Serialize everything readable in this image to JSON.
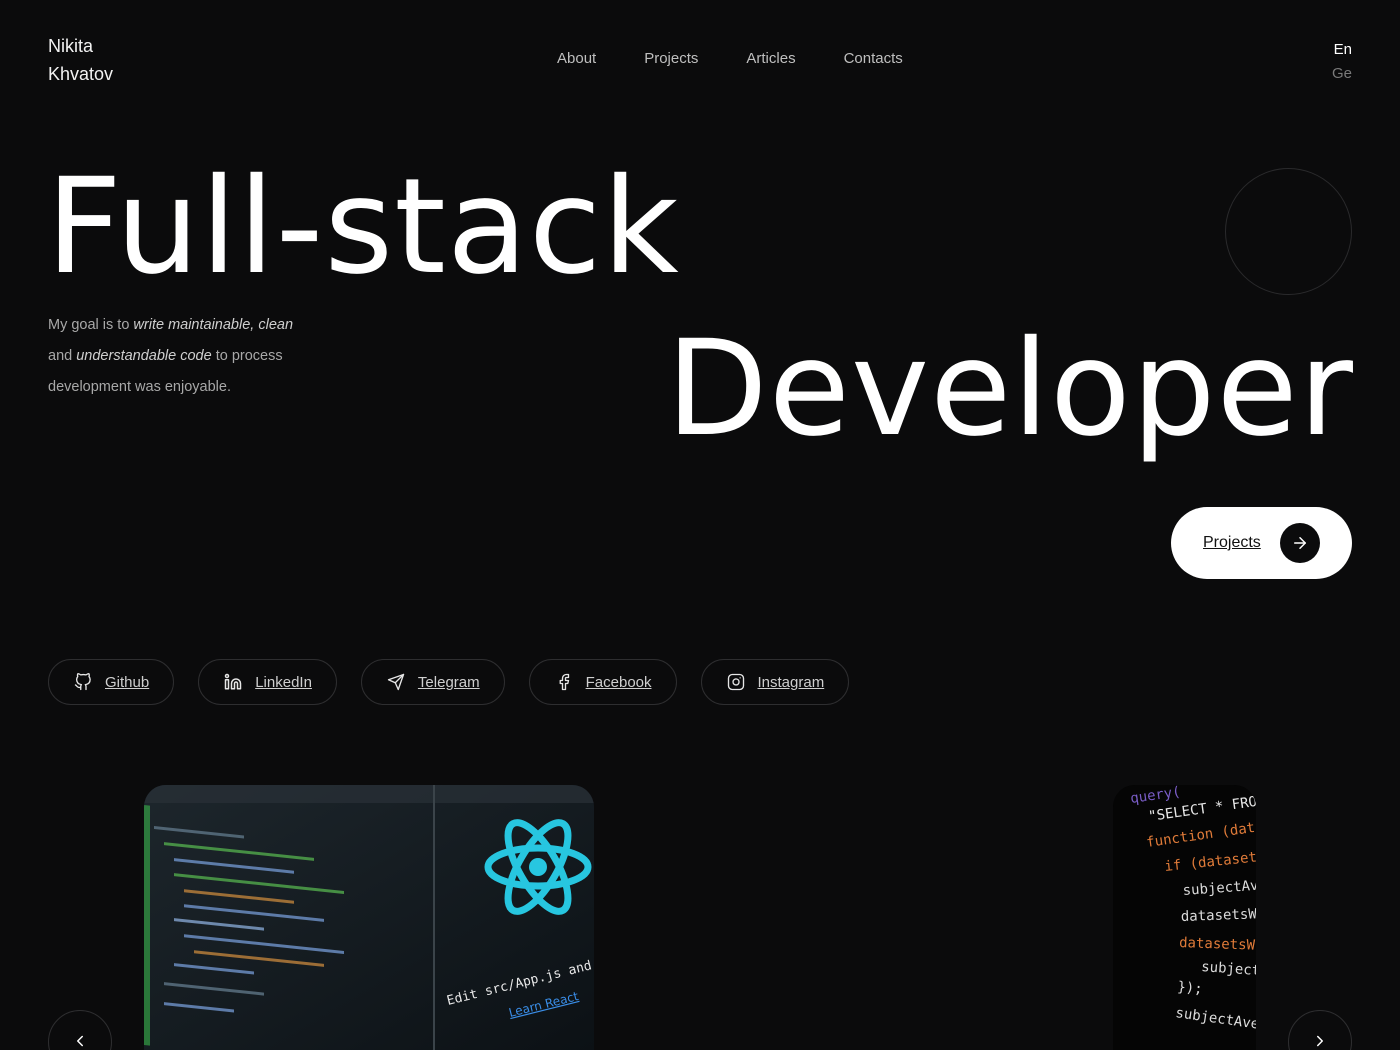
{
  "brand": {
    "first": "Nikita",
    "last": "Khvatov"
  },
  "nav": {
    "items": [
      "About",
      "Projects",
      "Articles",
      "Contacts"
    ]
  },
  "lang": {
    "active": "En",
    "inactive": "Ge"
  },
  "hero": {
    "line1": "Full-stack",
    "line2": "Developer"
  },
  "desc": {
    "p1": "My goal is to ",
    "em1": "write maintainable, clean",
    "p2": "and ",
    "em2": "understandable code",
    "p3": " to process development was enjoyable."
  },
  "cta": {
    "label": "Projects"
  },
  "socials": [
    "Github",
    "LinkedIn",
    "Telegram",
    "Facebook",
    "Instagram"
  ],
  "cards": {
    "card1": {
      "code_text": "Edit src/App.js and save to rel",
      "link_text": "Learn React"
    },
    "card2": {
      "lines": [
        "query(",
        "\"SELECT * FROM mark",
        "function (datasetsW",
        "if (datasetsWitl",
        "subjectAvera",
        "datasetsWith",
        "datasetsWith",
        "subjectA",
        "});",
        "subjectAverag"
      ]
    }
  },
  "colors": {
    "background": "#0b0b0c",
    "react_blue": "#27c6e0",
    "cta_bg": "#ffffff"
  },
  "icons": {
    "github": "github-icon",
    "linkedin": "linkedin-icon",
    "telegram": "telegram-icon",
    "facebook": "facebook-icon",
    "instagram": "instagram-icon",
    "arrow_right": "arrow-right-icon",
    "chevron_left": "chevron-left-icon",
    "chevron_right": "chevron-right-icon"
  }
}
